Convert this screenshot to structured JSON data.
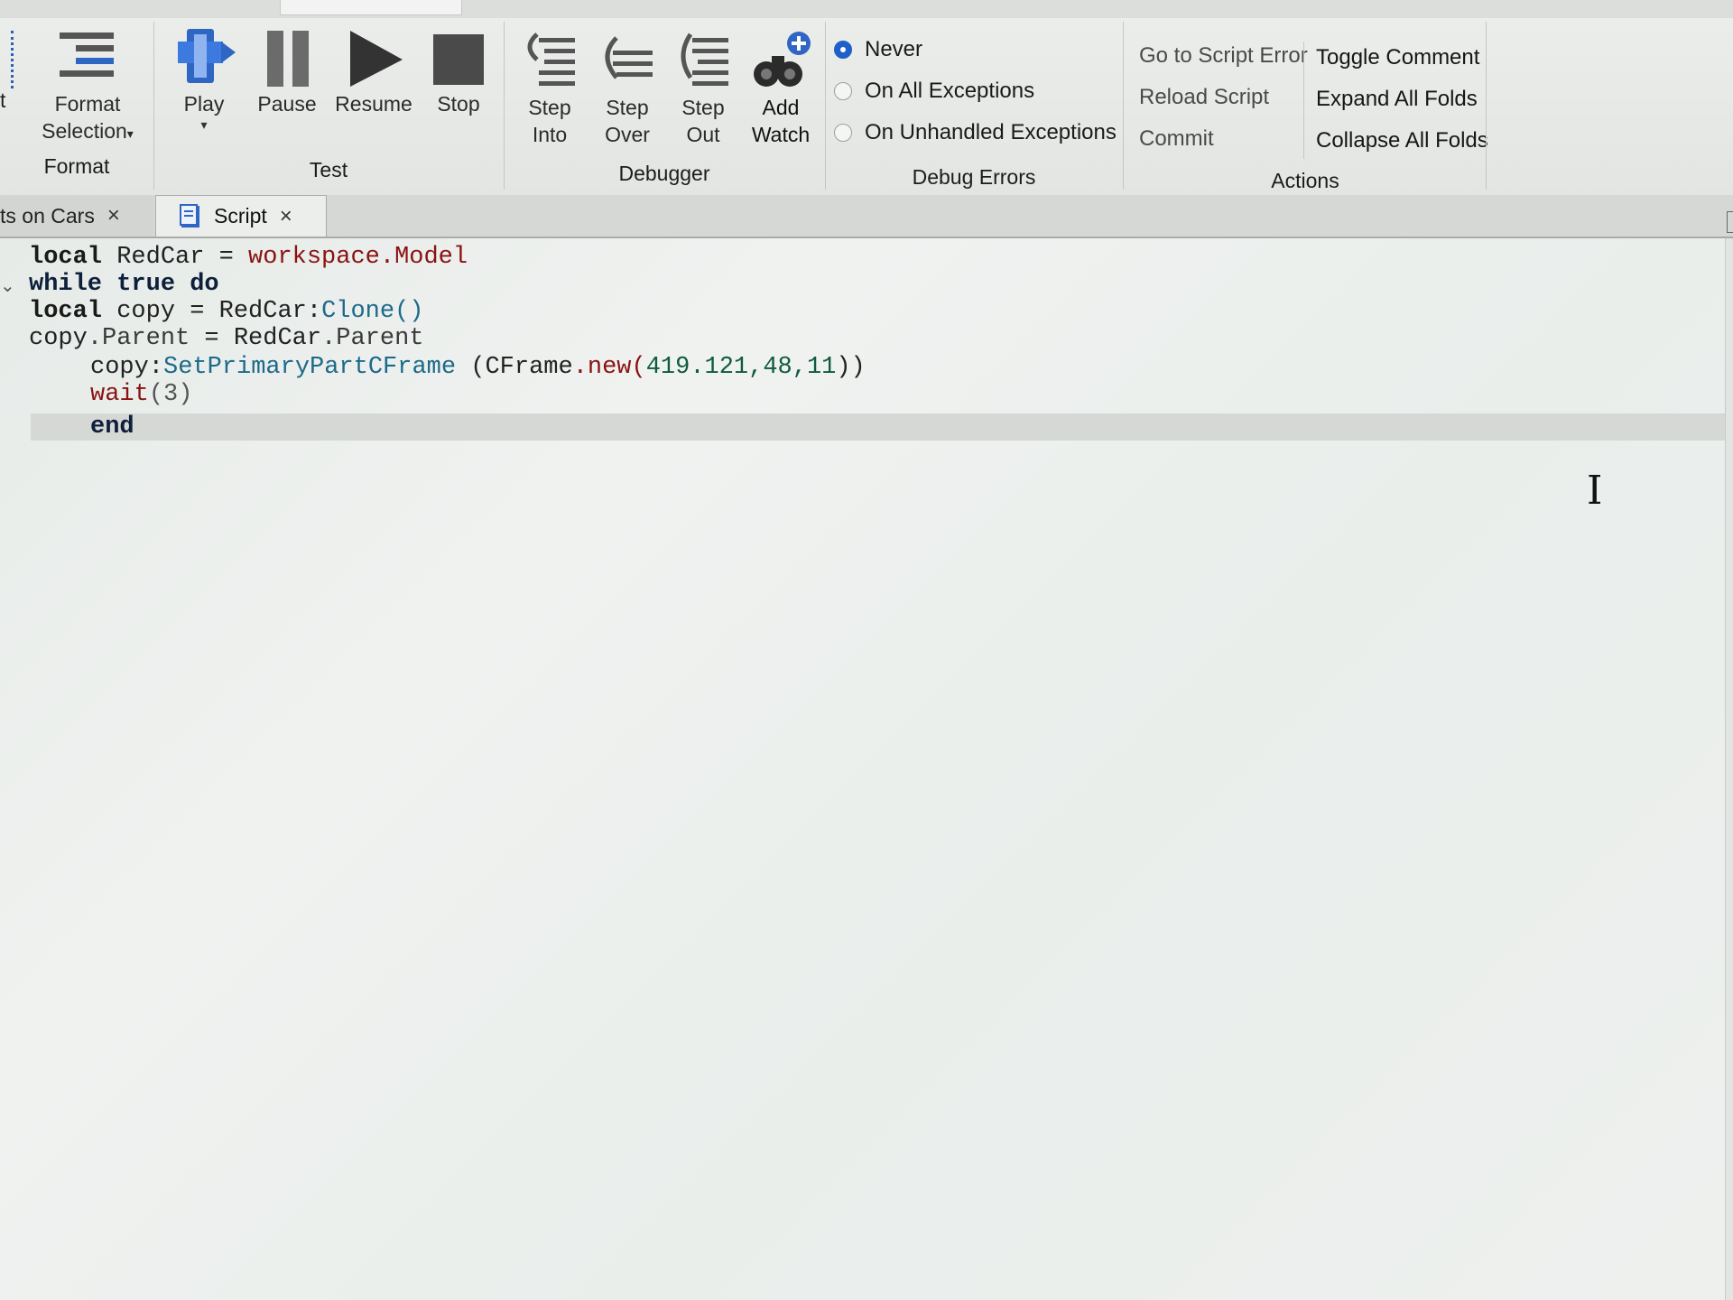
{
  "ribbon": {
    "format": {
      "button_label_1": "Format",
      "button_label_2": "Selection",
      "group_label": "Format",
      "partial_label": "t"
    },
    "test": {
      "play": "Play",
      "pause": "Pause",
      "resume": "Resume",
      "stop": "Stop",
      "group_label": "Test"
    },
    "debugger": {
      "step_into_1": "Step",
      "step_into_2": "Into",
      "step_over_1": "Step",
      "step_over_2": "Over",
      "step_out_1": "Step",
      "step_out_2": "Out",
      "add_watch_1": "Add",
      "add_watch_2": "Watch",
      "group_label": "Debugger"
    },
    "debug_errors": {
      "options": [
        "Never",
        "On All Exceptions",
        "On Unhandled Exceptions"
      ],
      "selected": "Never",
      "group_label": "Debug Errors"
    },
    "actions": {
      "go_to_script_error": "Go to Script Error",
      "reload_script": "Reload Script",
      "commit": "Commit",
      "toggle_comment": "Toggle Comment",
      "expand_all_folds": "Expand All Folds",
      "collapse_all_folds": "Collapse All Folds",
      "group_label": "Actions"
    }
  },
  "tabs": [
    {
      "label": "ts on Cars",
      "close": "×"
    },
    {
      "label": "Script",
      "close": "×"
    }
  ],
  "code": {
    "l1": {
      "kw": "local",
      "a": " RedCar ",
      "eq": "=",
      "b": " ",
      "c": "workspace.Model"
    },
    "l2": {
      "kw1": "while",
      "kw2": " true",
      "kw3": " do"
    },
    "l3": {
      "kw": "local",
      "a": " copy ",
      "eq": "=",
      "b": " RedCar:",
      "c": "Clone()"
    },
    "l4": {
      "a": "copy",
      "b": ".Parent",
      "c": " = RedCar",
      "d": ".Parent"
    },
    "l5": {
      "a": "copy:",
      "b": "SetPrimaryPartCFrame",
      "c": " (CFrame",
      "d": ".new(",
      "e": "419.121,48,11",
      "f": "))"
    },
    "l6": {
      "a": "wait",
      "b": "(3)"
    },
    "l7": {
      "kw": "end"
    }
  },
  "colors": {
    "keyword": "#0d1f3a",
    "builtin": "#8a1212",
    "method": "#1c6a8a",
    "number": "#0f5b40",
    "radio_selected": "#1e5fc8"
  }
}
